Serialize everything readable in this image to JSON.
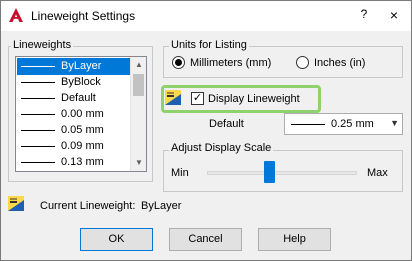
{
  "window": {
    "title": "Lineweight Settings",
    "help_glyph": "?",
    "close_glyph": "×"
  },
  "lineweights": {
    "group_title": "Lineweights",
    "items": [
      {
        "label": "ByLayer",
        "selected": true
      },
      {
        "label": "ByBlock",
        "selected": false
      },
      {
        "label": "Default",
        "selected": false
      },
      {
        "label": "0.00 mm",
        "selected": false
      },
      {
        "label": "0.05 mm",
        "selected": false
      },
      {
        "label": "0.09 mm",
        "selected": false
      },
      {
        "label": "0.13 mm",
        "selected": false
      }
    ]
  },
  "units": {
    "group_title": "Units for Listing",
    "millimeters_label": "Millimeters (mm)",
    "inches_label": "Inches (in)",
    "selected": "millimeters"
  },
  "display_lineweight": {
    "label": "Display Lineweight",
    "checked": true
  },
  "default": {
    "label": "Default",
    "value": "0.25 mm"
  },
  "scale": {
    "group_title": "Adjust Display Scale",
    "min_label": "Min",
    "max_label": "Max",
    "level": 0.4
  },
  "current": {
    "label": "Current Lineweight:",
    "value": "ByLayer"
  },
  "buttons": {
    "ok": "OK",
    "cancel": "Cancel",
    "help": "Help"
  },
  "colors": {
    "accent": "#0078d7",
    "highlight": "#8ed26b",
    "autocad_red": "#c8102e"
  }
}
